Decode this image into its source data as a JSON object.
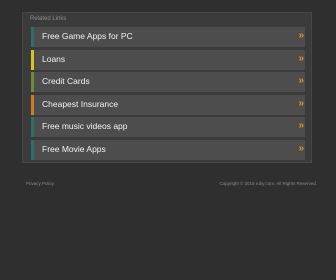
{
  "panel": {
    "title": "Related Links"
  },
  "links": [
    {
      "label": "Free Game Apps for PC",
      "accent": "#2f6f6a"
    },
    {
      "label": "Loans",
      "accent": "#d8c22a"
    },
    {
      "label": "Credit Cards",
      "accent": "#6f8a3a"
    },
    {
      "label": "Cheapest Insurance",
      "accent": "#d07a2a"
    },
    {
      "label": "Free music videos app",
      "accent": "#2f6f6a"
    },
    {
      "label": "Free Movie Apps",
      "accent": "#2f6f6a"
    }
  ],
  "arrow": {
    "glyph": "»",
    "color": "#e0902a"
  },
  "footer": {
    "privacy": "Privacy Policy",
    "copyright": "Copyright © 2015 ruby.com. All Rights Reserved."
  }
}
